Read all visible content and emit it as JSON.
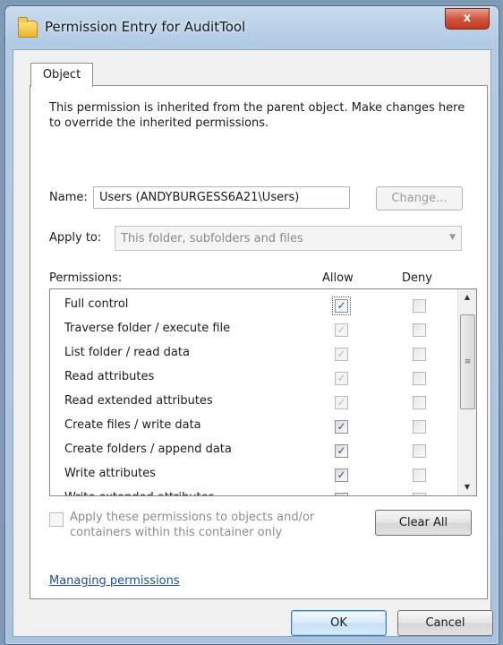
{
  "window": {
    "title": "Permission Entry for AuditTool",
    "close_label": "x"
  },
  "tabs": [
    {
      "label": "Object"
    }
  ],
  "description": "This permission is inherited from the parent object. Make changes here to override the inherited permissions.",
  "name_field": {
    "label": "Name:",
    "value": "Users (ANDYBURGESS6A21\\Users)",
    "change_button": "Change..."
  },
  "apply_to": {
    "label": "Apply to:",
    "value": "This folder, subfolders and files"
  },
  "permissions": {
    "label": "Permissions:",
    "col_allow": "Allow",
    "col_deny": "Deny",
    "rows": [
      {
        "name": "Full control",
        "allow": "checked-focus",
        "deny": "unchecked"
      },
      {
        "name": "Traverse folder / execute file",
        "allow": "inherited",
        "deny": "unchecked"
      },
      {
        "name": "List folder / read data",
        "allow": "inherited",
        "deny": "unchecked"
      },
      {
        "name": "Read attributes",
        "allow": "inherited",
        "deny": "unchecked"
      },
      {
        "name": "Read extended attributes",
        "allow": "inherited",
        "deny": "unchecked"
      },
      {
        "name": "Create files / write data",
        "allow": "checked",
        "deny": "unchecked"
      },
      {
        "name": "Create folders / append data",
        "allow": "checked",
        "deny": "unchecked"
      },
      {
        "name": "Write attributes",
        "allow": "checked",
        "deny": "unchecked"
      },
      {
        "name": "Write extended attributes",
        "allow": "checked",
        "deny": "unchecked"
      }
    ]
  },
  "apply_children": {
    "label": "Apply these permissions to objects and/or containers within this container only",
    "checked": false
  },
  "clear_all_button": "Clear All",
  "help_link": "Managing permissions",
  "footer": {
    "ok_label": "OK",
    "cancel_label": "Cancel"
  }
}
